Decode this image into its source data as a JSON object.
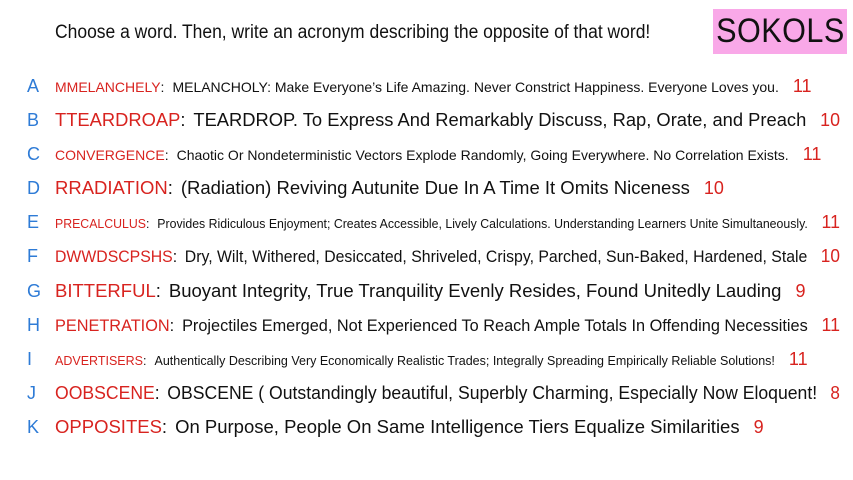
{
  "header": {
    "prompt": "Choose a word. Then, write an acronym describing the opposite of that word!",
    "badge": "SOKOLS"
  },
  "entries": [
    {
      "letter": "A",
      "word": "MMELANCHELY",
      "answer": "MELANCHOLY: Make Everyone’s Life Amazing. Never Constrict Happiness. Everyone Loves you.",
      "score": "11"
    },
    {
      "letter": "B",
      "word": "TTEARDROAP",
      "answer": "TEARDROP. To Express And Remarkably Discuss, Rap, Orate, and Preach",
      "score": "10"
    },
    {
      "letter": "C",
      "word": "CONVERGENCE",
      "answer": "Chaotic Or Nondeterministic Vectors Explode Randomly, Going Everywhere. No Correlation Exists.",
      "score": "11"
    },
    {
      "letter": "D",
      "word": "RRADIATION",
      "answer": "(Radiation) Reviving Autunite Due In A Time It Omits Niceness",
      "score": "10"
    },
    {
      "letter": "E",
      "word": "PRECALCULUS",
      "answer": "Provides Ridiculous Enjoyment; Creates Accessible, Lively Calculations. Understanding Learners Unite Simultaneously.",
      "score": "11"
    },
    {
      "letter": "F",
      "word": "DWWDSCPSHS",
      "answer": "Dry, Wilt, Withered, Desiccated, Shriveled, Crispy, Parched, Sun-Baked, Hardened, Stale",
      "score": "10"
    },
    {
      "letter": "G",
      "word": "BITTERFUL",
      "answer": "Buoyant Integrity, True Tranquility Evenly Resides, Found Unitedly Lauding",
      "score": "9"
    },
    {
      "letter": "H",
      "word": "PENETRATION",
      "answer": "Projectiles Emerged, Not Experienced To Reach Ample Totals In Offending Necessities",
      "score": "11"
    },
    {
      "letter": "I",
      "word": "ADVERTISERS",
      "answer": "Authentically Describing Very Economically Realistic Trades; Integrally Spreading Empirically Reliable Solutions!",
      "score": "11"
    },
    {
      "letter": "J",
      "word": "OOBSCENE",
      "answer": "OBSCENE ( Outstandingly beautiful, Superbly Charming, Especially Now Eloquent!",
      "score": "8"
    },
    {
      "letter": "K",
      "word": "OPPOSITES",
      "answer": "On Purpose, People On Same Intelligence Tiers Equalize Similarities",
      "score": "9"
    }
  ],
  "colors": {
    "letter": "#2e7bd6",
    "word": "#d8231f",
    "score": "#d8231f",
    "badge_bg": "#f9a8e8"
  }
}
